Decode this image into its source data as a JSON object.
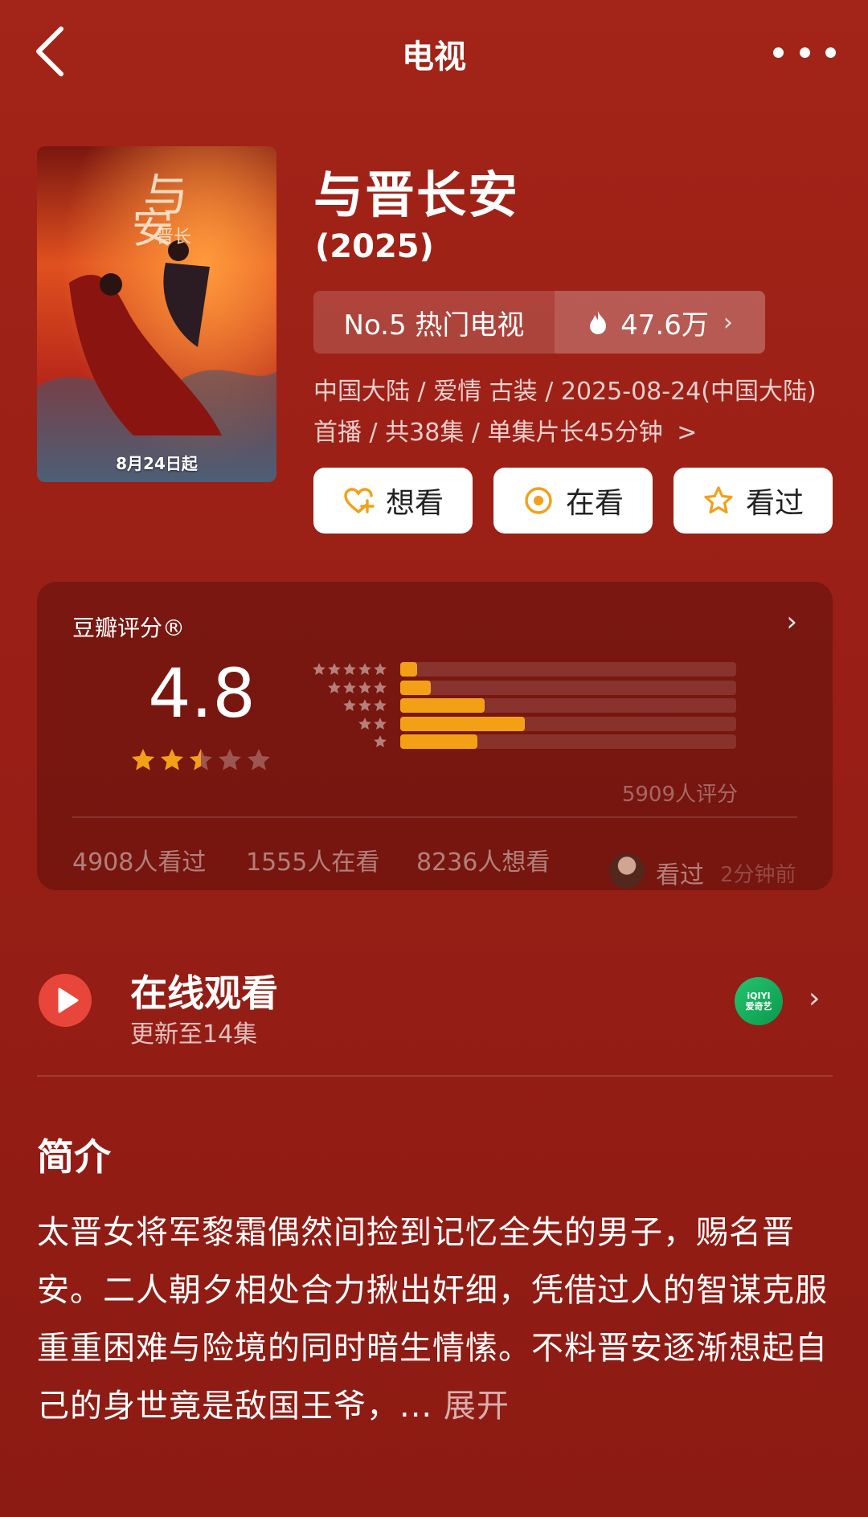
{
  "header": {
    "title": "电视"
  },
  "poster": {
    "date_text": "8月24日起"
  },
  "show": {
    "title": "与晋长安",
    "year": "(2025)",
    "rank_label": "No.5 热门电视",
    "heat": "47.6万",
    "meta": "中国大陆 / 爱情 古装 / 2025-08-24(中国大陆)首播 / 共38集 / 单集片长45分钟",
    "meta_chevron": ">"
  },
  "actions": {
    "want": "想看",
    "watching": "在看",
    "watched": "看过"
  },
  "rating": {
    "label": "豆瓣评分®",
    "score": "4.8",
    "stars_value": 2.5,
    "distribution": [
      {
        "stars": 5,
        "fraction": 0.05
      },
      {
        "stars": 4,
        "fraction": 0.09
      },
      {
        "stars": 3,
        "fraction": 0.25
      },
      {
        "stars": 2,
        "fraction": 0.37
      },
      {
        "stars": 1,
        "fraction": 0.23
      }
    ],
    "count_text": "5909人评分",
    "watched_count": "4908人看过",
    "watching_count": "1555人在看",
    "want_count": "8236人想看",
    "recent_label": "看过",
    "recent_time": "2分钟前"
  },
  "online": {
    "title": "在线观看",
    "subtitle": "更新至14集",
    "platform_logo_text": "iQIYI",
    "platform_name": "爱奇艺"
  },
  "synopsis": {
    "title": "简介",
    "text": "太晋女将军黎霜偶然间捡到记忆全失的男子，赐名晋安。二人朝夕相处合力揪出奸细，凭借过人的智谋克服重重困难与险境的同时暗生情愫。不料晋安逐渐想起自己的身世竟是敌国王爷，... ",
    "expand": "展开"
  },
  "colors": {
    "background": "#9a1f16",
    "accent_star": "#f3a017",
    "play_button": "#e8463a"
  }
}
